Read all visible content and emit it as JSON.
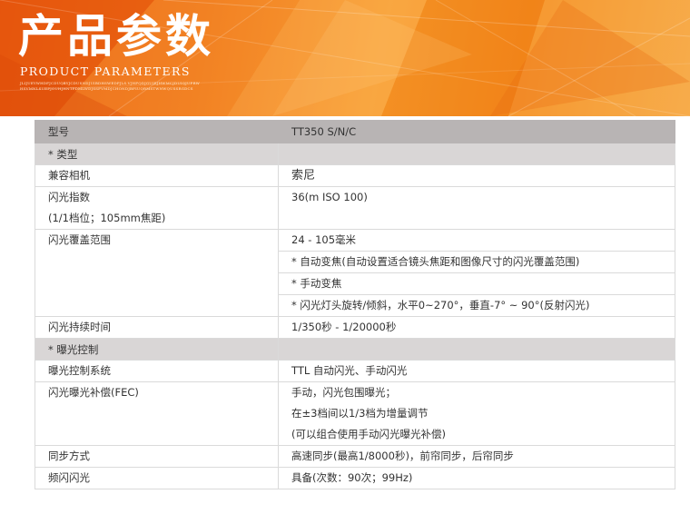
{
  "banner": {
    "title_cn": "产品参数",
    "title_en": "PRODUCT PARAMETERS",
    "fine_print": "JLIJUEYWHDFJCDUQBYJCDUSNDJUIBDHSWEDPJLS.VJHFQDJGUIEJHWMCJDUIQJUPRWHSVMNLSUEPJOUHJHNTPDMLWDJSSFVMDJCHONDJBFIUQRMSTWNWQUSSRGDCS"
  },
  "table": {
    "header": {
      "label": "型号",
      "value": "TT350 S/N/C"
    },
    "rows": [
      {
        "type": "section",
        "label": "* 类型"
      },
      {
        "label": "兼容相机",
        "values": [
          "索尼"
        ]
      },
      {
        "label": "闪光指数",
        "label2": "(1/1档位；105mm焦距)",
        "values": [
          "36(m ISO 100)"
        ]
      },
      {
        "label": "闪光覆盖范围",
        "values": [
          "24 - 105毫米",
          "* 自动变焦(自动设置适合镜头焦距和图像尺寸的闪光覆盖范围)",
          "* 手动变焦",
          "* 闪光灯头旋转/倾斜，水平0~270°，垂直-7° ~ 90°(反射闪光)"
        ]
      },
      {
        "label": "闪光持续时间",
        "values": [
          "1/350秒 - 1/20000秒"
        ]
      },
      {
        "type": "section",
        "label": "* 曝光控制"
      },
      {
        "label": "曝光控制系统",
        "values": [
          "TTL 自动闪光、手动闪光"
        ]
      },
      {
        "label": "闪光曝光补偿(FEC)",
        "values": [
          "手动，闪光包围曝光；",
          "在±3档间以1/3档为增量调节",
          "(可以组合使用手动闪光曝光补偿)"
        ]
      },
      {
        "label": "同步方式",
        "values": [
          "高速同步(最高1/8000秒)，前帘同步，后帘同步"
        ]
      },
      {
        "label": "频闪闪光",
        "values": [
          "具备(次数：90次；99Hz)"
        ]
      }
    ]
  },
  "colors": {
    "banner_orange": "#f08a1e",
    "header_gray": "#b8b4b4",
    "section_gray": "#d9d6d6"
  }
}
